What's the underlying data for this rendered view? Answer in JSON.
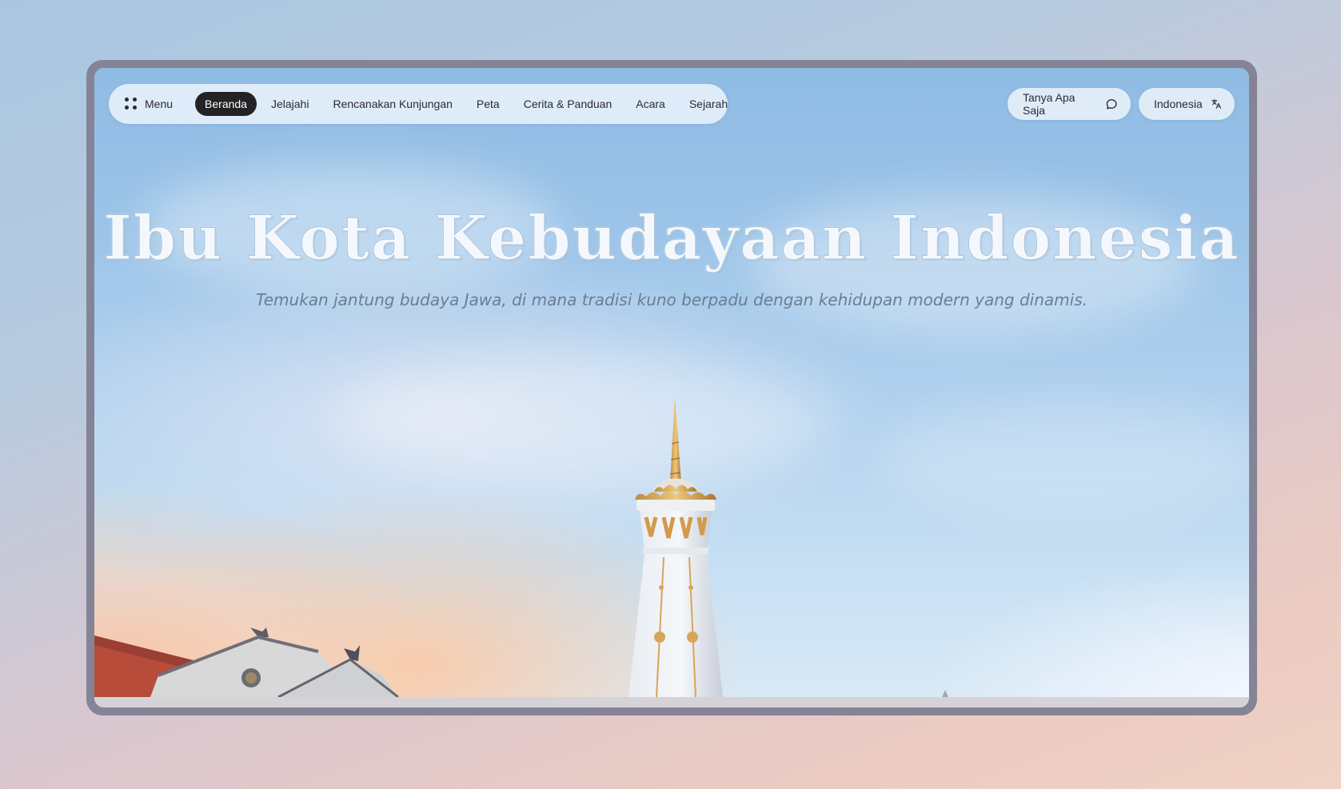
{
  "nav": {
    "menu_label": "Menu",
    "links": [
      {
        "label": "Beranda",
        "active": true
      },
      {
        "label": "Jelajahi",
        "active": false
      },
      {
        "label": "Rencanakan Kunjungan",
        "active": false
      },
      {
        "label": "Peta",
        "active": false
      },
      {
        "label": "Cerita & Panduan",
        "active": false
      },
      {
        "label": "Acara",
        "active": false
      },
      {
        "label": "Sejarah",
        "active": false
      }
    ]
  },
  "actions": {
    "ask_label": "Tanya Apa Saja",
    "ask_icon": "chat-bubble-icon",
    "language_label": "Indonesia",
    "language_icon": "translate-icon"
  },
  "hero": {
    "title": "Ibu Kota Kebudayaan Indonesia",
    "subtitle": "Temukan jantung budaya Jawa, di mana tradisi kuno berpadu dengan kehidupan modern yang dinamis."
  },
  "colors": {
    "active_tab_bg": "#232326",
    "nav_bg": "#e8f1fa",
    "frame": "#858496"
  }
}
